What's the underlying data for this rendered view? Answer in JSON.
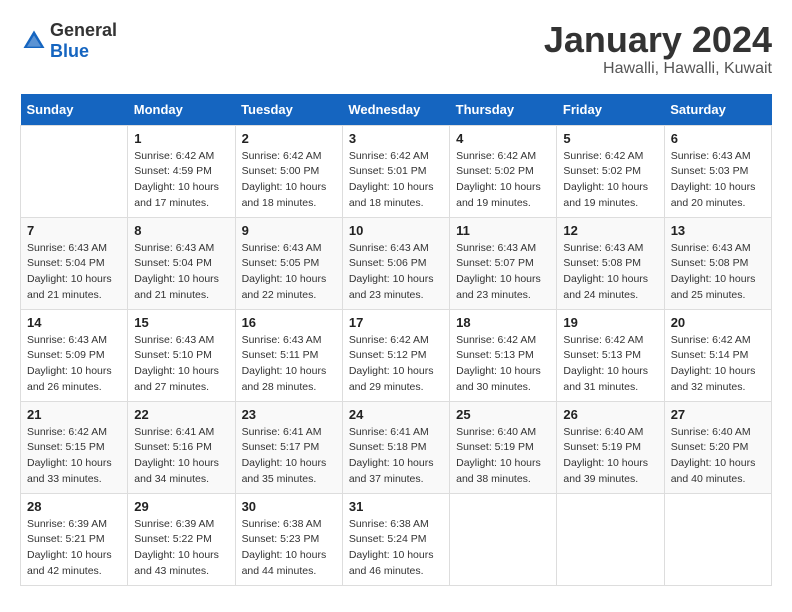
{
  "logo": {
    "general": "General",
    "blue": "Blue"
  },
  "title": "January 2024",
  "subtitle": "Hawalli, Hawalli, Kuwait",
  "weekdays": [
    "Sunday",
    "Monday",
    "Tuesday",
    "Wednesday",
    "Thursday",
    "Friday",
    "Saturday"
  ],
  "weeks": [
    [
      {
        "day": "",
        "sunrise": "",
        "sunset": "",
        "daylight": ""
      },
      {
        "day": "1",
        "sunrise": "Sunrise: 6:42 AM",
        "sunset": "Sunset: 4:59 PM",
        "daylight": "Daylight: 10 hours and 17 minutes."
      },
      {
        "day": "2",
        "sunrise": "Sunrise: 6:42 AM",
        "sunset": "Sunset: 5:00 PM",
        "daylight": "Daylight: 10 hours and 18 minutes."
      },
      {
        "day": "3",
        "sunrise": "Sunrise: 6:42 AM",
        "sunset": "Sunset: 5:01 PM",
        "daylight": "Daylight: 10 hours and 18 minutes."
      },
      {
        "day": "4",
        "sunrise": "Sunrise: 6:42 AM",
        "sunset": "Sunset: 5:02 PM",
        "daylight": "Daylight: 10 hours and 19 minutes."
      },
      {
        "day": "5",
        "sunrise": "Sunrise: 6:42 AM",
        "sunset": "Sunset: 5:02 PM",
        "daylight": "Daylight: 10 hours and 19 minutes."
      },
      {
        "day": "6",
        "sunrise": "Sunrise: 6:43 AM",
        "sunset": "Sunset: 5:03 PM",
        "daylight": "Daylight: 10 hours and 20 minutes."
      }
    ],
    [
      {
        "day": "7",
        "sunrise": "Sunrise: 6:43 AM",
        "sunset": "Sunset: 5:04 PM",
        "daylight": "Daylight: 10 hours and 21 minutes."
      },
      {
        "day": "8",
        "sunrise": "Sunrise: 6:43 AM",
        "sunset": "Sunset: 5:04 PM",
        "daylight": "Daylight: 10 hours and 21 minutes."
      },
      {
        "day": "9",
        "sunrise": "Sunrise: 6:43 AM",
        "sunset": "Sunset: 5:05 PM",
        "daylight": "Daylight: 10 hours and 22 minutes."
      },
      {
        "day": "10",
        "sunrise": "Sunrise: 6:43 AM",
        "sunset": "Sunset: 5:06 PM",
        "daylight": "Daylight: 10 hours and 23 minutes."
      },
      {
        "day": "11",
        "sunrise": "Sunrise: 6:43 AM",
        "sunset": "Sunset: 5:07 PM",
        "daylight": "Daylight: 10 hours and 23 minutes."
      },
      {
        "day": "12",
        "sunrise": "Sunrise: 6:43 AM",
        "sunset": "Sunset: 5:08 PM",
        "daylight": "Daylight: 10 hours and 24 minutes."
      },
      {
        "day": "13",
        "sunrise": "Sunrise: 6:43 AM",
        "sunset": "Sunset: 5:08 PM",
        "daylight": "Daylight: 10 hours and 25 minutes."
      }
    ],
    [
      {
        "day": "14",
        "sunrise": "Sunrise: 6:43 AM",
        "sunset": "Sunset: 5:09 PM",
        "daylight": "Daylight: 10 hours and 26 minutes."
      },
      {
        "day": "15",
        "sunrise": "Sunrise: 6:43 AM",
        "sunset": "Sunset: 5:10 PM",
        "daylight": "Daylight: 10 hours and 27 minutes."
      },
      {
        "day": "16",
        "sunrise": "Sunrise: 6:43 AM",
        "sunset": "Sunset: 5:11 PM",
        "daylight": "Daylight: 10 hours and 28 minutes."
      },
      {
        "day": "17",
        "sunrise": "Sunrise: 6:42 AM",
        "sunset": "Sunset: 5:12 PM",
        "daylight": "Daylight: 10 hours and 29 minutes."
      },
      {
        "day": "18",
        "sunrise": "Sunrise: 6:42 AM",
        "sunset": "Sunset: 5:13 PM",
        "daylight": "Daylight: 10 hours and 30 minutes."
      },
      {
        "day": "19",
        "sunrise": "Sunrise: 6:42 AM",
        "sunset": "Sunset: 5:13 PM",
        "daylight": "Daylight: 10 hours and 31 minutes."
      },
      {
        "day": "20",
        "sunrise": "Sunrise: 6:42 AM",
        "sunset": "Sunset: 5:14 PM",
        "daylight": "Daylight: 10 hours and 32 minutes."
      }
    ],
    [
      {
        "day": "21",
        "sunrise": "Sunrise: 6:42 AM",
        "sunset": "Sunset: 5:15 PM",
        "daylight": "Daylight: 10 hours and 33 minutes."
      },
      {
        "day": "22",
        "sunrise": "Sunrise: 6:41 AM",
        "sunset": "Sunset: 5:16 PM",
        "daylight": "Daylight: 10 hours and 34 minutes."
      },
      {
        "day": "23",
        "sunrise": "Sunrise: 6:41 AM",
        "sunset": "Sunset: 5:17 PM",
        "daylight": "Daylight: 10 hours and 35 minutes."
      },
      {
        "day": "24",
        "sunrise": "Sunrise: 6:41 AM",
        "sunset": "Sunset: 5:18 PM",
        "daylight": "Daylight: 10 hours and 37 minutes."
      },
      {
        "day": "25",
        "sunrise": "Sunrise: 6:40 AM",
        "sunset": "Sunset: 5:19 PM",
        "daylight": "Daylight: 10 hours and 38 minutes."
      },
      {
        "day": "26",
        "sunrise": "Sunrise: 6:40 AM",
        "sunset": "Sunset: 5:19 PM",
        "daylight": "Daylight: 10 hours and 39 minutes."
      },
      {
        "day": "27",
        "sunrise": "Sunrise: 6:40 AM",
        "sunset": "Sunset: 5:20 PM",
        "daylight": "Daylight: 10 hours and 40 minutes."
      }
    ],
    [
      {
        "day": "28",
        "sunrise": "Sunrise: 6:39 AM",
        "sunset": "Sunset: 5:21 PM",
        "daylight": "Daylight: 10 hours and 42 minutes."
      },
      {
        "day": "29",
        "sunrise": "Sunrise: 6:39 AM",
        "sunset": "Sunset: 5:22 PM",
        "daylight": "Daylight: 10 hours and 43 minutes."
      },
      {
        "day": "30",
        "sunrise": "Sunrise: 6:38 AM",
        "sunset": "Sunset: 5:23 PM",
        "daylight": "Daylight: 10 hours and 44 minutes."
      },
      {
        "day": "31",
        "sunrise": "Sunrise: 6:38 AM",
        "sunset": "Sunset: 5:24 PM",
        "daylight": "Daylight: 10 hours and 46 minutes."
      },
      {
        "day": "",
        "sunrise": "",
        "sunset": "",
        "daylight": ""
      },
      {
        "day": "",
        "sunrise": "",
        "sunset": "",
        "daylight": ""
      },
      {
        "day": "",
        "sunrise": "",
        "sunset": "",
        "daylight": ""
      }
    ]
  ]
}
